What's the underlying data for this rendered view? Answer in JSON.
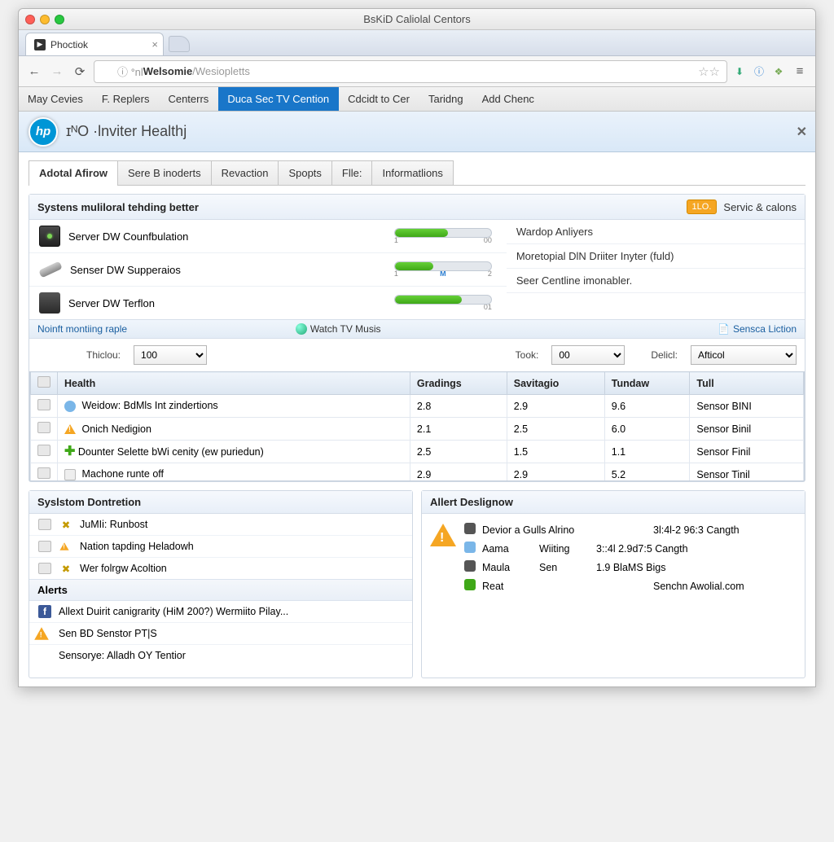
{
  "window": {
    "title": "BsKiD Caliolal Centors"
  },
  "browser": {
    "tab_name": "Phoctiok",
    "url_prefix": "ⓘ ᐤnl ",
    "url_bold": "Welsomie",
    "url_suffix": " /Wesiopletts"
  },
  "menubar": [
    "May Cevies",
    "F. Replers",
    "Centerrs",
    "Duca Sec TV Cention",
    "Cdcidt to Cer",
    "Taridng",
    "Add Chenc"
  ],
  "menubar_active_index": 3,
  "app": {
    "logo": "hp",
    "title": "ɪᴺO ·lnviter Healthj"
  },
  "subtabs": [
    "Adotal Afirow",
    "Sere B inoderts",
    "Revaction",
    "Spopts",
    "Flle:",
    "Informatlions"
  ],
  "subtabs_active_index": 0,
  "health_panel": {
    "title": "Systens muliloral tehding better",
    "badge": "1LO.",
    "right_link": "Servic & calons",
    "left_items": [
      {
        "icon": "disk",
        "label": "Server DW Counfbulation",
        "fill": 55,
        "tick1": "1",
        "tick2": "00"
      },
      {
        "icon": "stick",
        "label": "Senser DW Supperaios",
        "fill": 40,
        "tick1": "1",
        "tickM": "M",
        "tick2": "2"
      },
      {
        "icon": "server",
        "label": "Server DW Terflon",
        "fill": 70,
        "tick1": "",
        "tick2": "01"
      }
    ],
    "right_items": [
      "Wardop Anliyers",
      "Moretopial DlN Driiter Inyter (fuld)",
      "Seer Centline imonabler."
    ],
    "subbar": {
      "left": "Noinft montiing raple",
      "mid": "Watch TV Musis",
      "right": "Sensca Liction"
    }
  },
  "filters": {
    "label1": "Thiclou:",
    "val1": "100",
    "label2": "Took:",
    "val2": "00",
    "label3": "Delicl:",
    "val3": "Afticol"
  },
  "table": {
    "cols": [
      "",
      "Health",
      "Gradings",
      "Savitagio",
      "Tundaw",
      "Tull"
    ],
    "rows": [
      {
        "icon": "user",
        "health": "Weidow: BdMls Int zindertions",
        "g": "2.8",
        "s": "2.9",
        "t": "9.6",
        "tu": "Sensor BINI"
      },
      {
        "icon": "warn",
        "health": "Onich Nedigion",
        "g": "2.1",
        "s": "2.5",
        "t": "6.0",
        "tu": "Sensor Binil"
      },
      {
        "icon": "plus",
        "health": "Dounter Selette bWi cenity (ew puriedun)",
        "g": "2.5",
        "s": "1.5",
        "t": "1.1",
        "tu": "Sensor Finil"
      },
      {
        "icon": "file",
        "health": "Machone runte off",
        "g": "2.9",
        "s": "2.9",
        "t": "5.2",
        "tu": "Sensor Tinil"
      }
    ]
  },
  "syslstom": {
    "title": "Syslstom Dontretion",
    "items": [
      {
        "icons": "file tools",
        "label": "JuMIi: Runbost"
      },
      {
        "icons": "file warn",
        "label": "Nation tapding Heladowh"
      },
      {
        "icons": "file tools",
        "label": "Wer folrgw Acoltion"
      }
    ],
    "alerts_title": "Alerts",
    "alerts": [
      {
        "icon": "fb",
        "label": "Allext Duirit canigrarity (HiM 200?) Wermiito Pilay..."
      },
      {
        "icon": "warn-large",
        "label": "Sen BD Senstor PT|S"
      },
      {
        "icon": "none",
        "label": "Sensorye: Alladh OY Tentior"
      }
    ]
  },
  "alert_design": {
    "title": "Allert Deslignow",
    "rows": [
      {
        "ic": "server",
        "c2": "Devior a Gulls Alrino",
        "c3": "",
        "c4": "3l:4l-2 96:3 Cangth"
      },
      {
        "ic": "user",
        "c2": "Aama",
        "c3": "Wiiting",
        "c4": "3::4l 2.9d7:5 Cangth"
      },
      {
        "ic": "server",
        "c2": "Maula",
        "c3": "Sen",
        "c4": "1.9 BlaMS Bigs"
      },
      {
        "ic": "green",
        "c2": "Reat",
        "c3": "",
        "c4": "Senchn Awolial.com"
      }
    ]
  }
}
